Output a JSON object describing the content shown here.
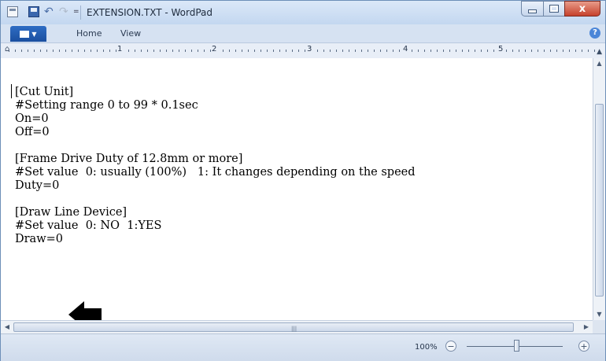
{
  "window": {
    "title": "EXTENSION.TXT - WordPad",
    "quick_access": {
      "dropdown": "="
    },
    "caption_close": "x"
  },
  "ribbon": {
    "tabs": [
      "Home",
      "View"
    ],
    "help": "?"
  },
  "ruler": {
    "numbers": [
      "1",
      "2",
      "3",
      "4",
      "5"
    ]
  },
  "document": {
    "lines": [
      "[Cut Unit]",
      "#Setting range 0 to 99 * 0.1sec",
      "On=0",
      "Off=0",
      "",
      "[Frame Drive Duty of 12.8mm or more]",
      "#Set value  0: usually (100%)   1: It changes depending on the speed",
      "Duty=0",
      "",
      "[Draw Line Device]",
      "#Set value  0: NO  1:YES",
      "Draw=0"
    ]
  },
  "statusbar": {
    "zoom_level": "100%",
    "zoom_out": "−",
    "zoom_in": "+",
    "zoom_fraction": 0.5
  },
  "colors": {
    "titlebar": "#c3d7f0",
    "close_button": "#c6412c",
    "app_menu": "#1b4f9f"
  }
}
